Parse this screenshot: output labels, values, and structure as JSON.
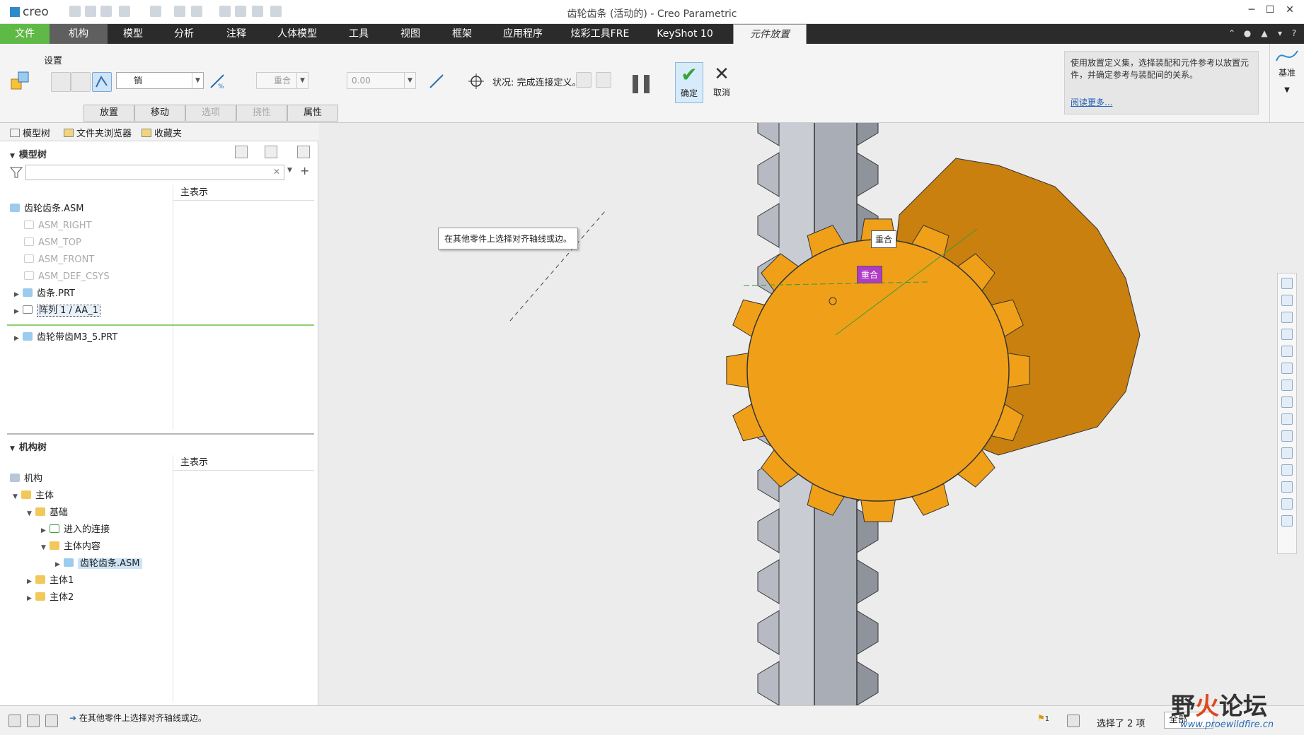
{
  "app": {
    "logo": "creo",
    "window_title": "齿轮齿条 (活动的) - Creo Parametric"
  },
  "menu": {
    "tabs": [
      "文件",
      "机构",
      "模型",
      "分析",
      "注释",
      "人体模型",
      "工具",
      "视图",
      "框架",
      "应用程序",
      "炫彩工具FRE",
      "KeyShot 10",
      "元件放置"
    ]
  },
  "ribbon": {
    "settings_label": "设置",
    "connection_type": "销",
    "constraint_type": "重合",
    "offset_value": "0.00",
    "status": "状况: 完成连接定义。",
    "ok_label": "确定",
    "cancel_label": "取消",
    "subtabs": [
      "放置",
      "移动",
      "选项",
      "挠性",
      "属性"
    ],
    "help_text": "使用放置定义集，选择装配和元件参考以放置元件，并确定参考与装配间的关系。",
    "help_link": "阅读更多...",
    "datum_label": "基准"
  },
  "left_panel": {
    "tabs": [
      "模型树",
      "文件夹浏览器",
      "收藏夹"
    ],
    "model_tree_header": "模型树",
    "column_header": "主表示",
    "model_tree": [
      {
        "label": "齿轮齿条.ASM",
        "dim": false
      },
      {
        "label": "ASM_RIGHT",
        "dim": true
      },
      {
        "label": "ASM_TOP",
        "dim": true
      },
      {
        "label": "ASM_FRONT",
        "dim": true
      },
      {
        "label": "ASM_DEF_CSYS",
        "dim": true
      },
      {
        "label": "齿条.PRT",
        "dim": false
      },
      {
        "label": "阵列 1 / AA_1",
        "dim": false
      },
      {
        "label": "齿轮带齿M3_5.PRT",
        "dim": false
      }
    ],
    "mech_tree_header": "机构树",
    "mech_column_header": "主表示",
    "mech_tree": [
      {
        "label": "机构"
      },
      {
        "label": "主体"
      },
      {
        "label": "基础"
      },
      {
        "label": "进入的连接"
      },
      {
        "label": "主体内容"
      },
      {
        "label": "齿轮齿条.ASM"
      },
      {
        "label": "主体1"
      },
      {
        "label": "主体2"
      }
    ]
  },
  "viewport": {
    "tooltip": "在其他零件上选择对齐轴线或边。",
    "tag1": "重合",
    "tag2": "重合",
    "colors": {
      "gear": "#f0a018",
      "rack": "#a9adb6",
      "tag_purple": "#b03cc6"
    }
  },
  "statusbar": {
    "message": "在其他零件上选择对齐轴线或边。",
    "flag_count": "1",
    "selected": "选择了 2 项",
    "filter": "全部"
  },
  "watermark": {
    "text_a": "野",
    "text_b": "火",
    "text_c": "论坛",
    "url": "www.proewildfire.cn"
  }
}
